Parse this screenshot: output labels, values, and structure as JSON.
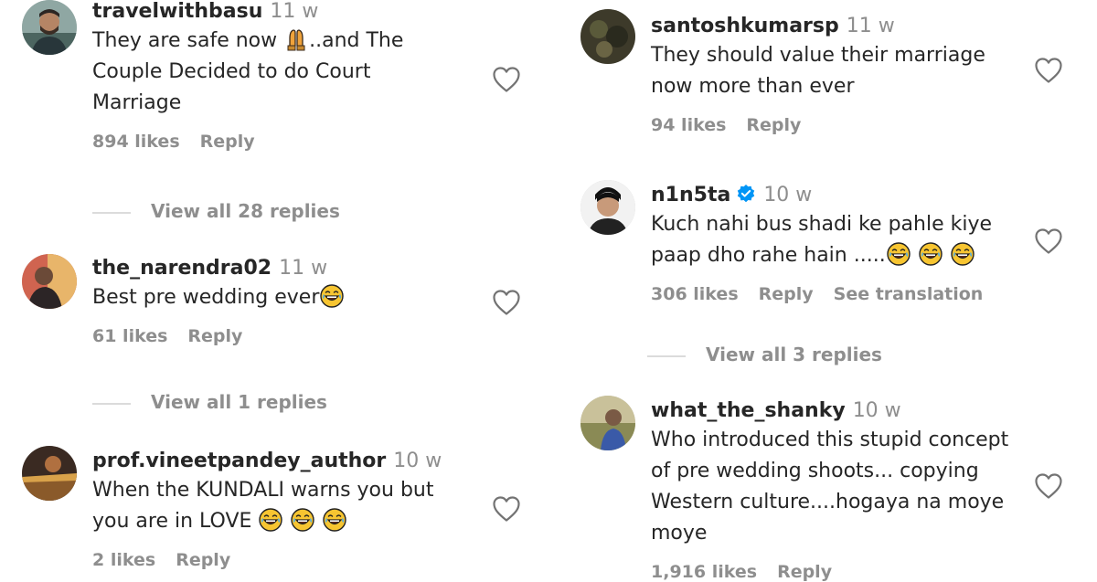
{
  "left": {
    "comments": [
      {
        "username": "travelwithbasu",
        "time": "11 w",
        "text_a": "They are safe now",
        "text_b": "..and The",
        "text_c": "Couple Decided to do Court",
        "text_d": "Marriage",
        "likes": "894 likes",
        "reply": "Reply",
        "replies": "View all 28 replies"
      },
      {
        "username": "the_narendra02",
        "time": "11 w",
        "text": "Best pre wedding ever",
        "likes": "61 likes",
        "reply": "Reply",
        "replies": "View all 1 replies"
      },
      {
        "username": "prof.vineetpandey_author",
        "time": "10 w",
        "text_a": "When the KUNDALI warns you but",
        "text_b": "you are in LOVE",
        "likes": "2 likes",
        "reply": "Reply"
      }
    ]
  },
  "right": {
    "comments": [
      {
        "username": "santoshkumarsp",
        "time": "11 w",
        "text_a": "They should value their marriage",
        "text_b": "now more than ever",
        "likes": "94 likes",
        "reply": "Reply"
      },
      {
        "username": "n1n5ta",
        "time": "10 w",
        "text_a": "Kuch nahi bus shadi ke pahle kiye",
        "text_b": "paap dho rahe hain .....",
        "likes": "306 likes",
        "reply": "Reply",
        "translate": "See translation",
        "replies": "View all 3 replies"
      },
      {
        "username": "what_the_shanky",
        "time": "10 w",
        "text_a": "Who introduced this stupid concept",
        "text_b": "of pre wedding shoots... copying",
        "text_c": "Western culture....hogaya na moye",
        "text_d": "moye",
        "likes": "1,916 likes",
        "reply": "Reply"
      }
    ]
  },
  "colors": {
    "text": "#262626",
    "secondary": "#8e8e8e",
    "verified": "#0095f6",
    "divider": "#dbdbdb"
  },
  "icons": {
    "like": "heart-outline-icon",
    "verified": "verified-badge-icon",
    "emoji_pray": "hands-raised-emoji",
    "emoji_laugh": "tears-of-joy-emoji"
  }
}
